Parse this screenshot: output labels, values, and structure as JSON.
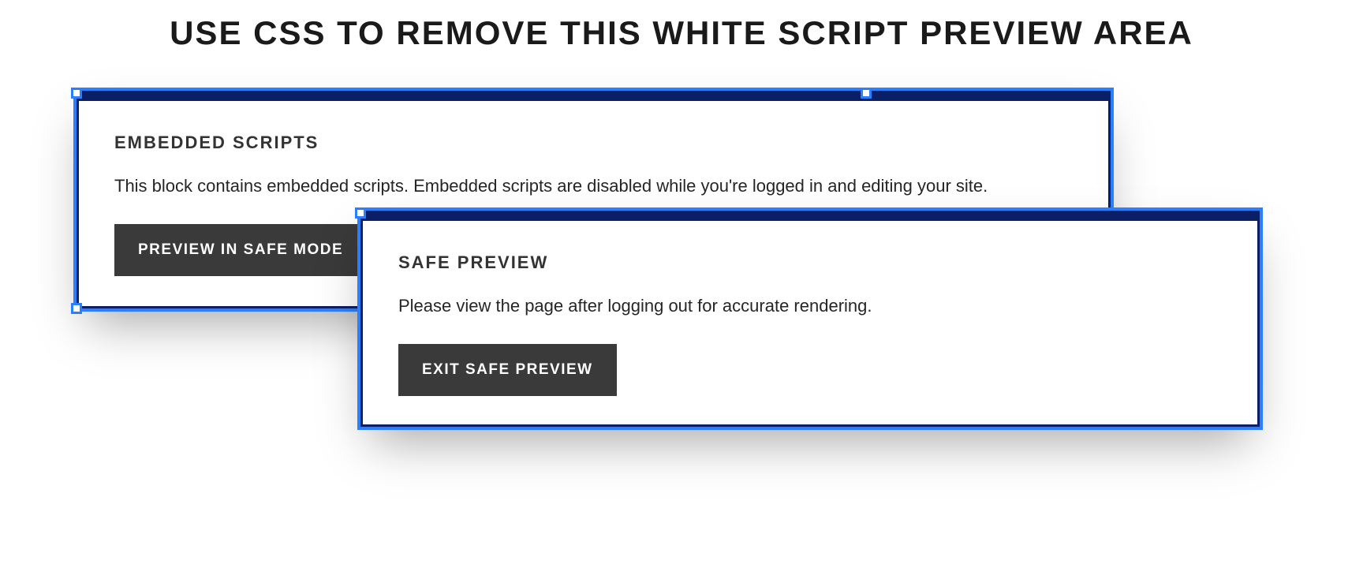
{
  "heading": "USE CSS TO REMOVE THIS WHITE SCRIPT PREVIEW AREA",
  "embedded": {
    "title": "EMBEDDED SCRIPTS",
    "text": "This block contains embedded scripts. Embedded scripts are disabled while you're logged in and editing your site.",
    "button": "PREVIEW IN SAFE MODE"
  },
  "safe": {
    "title": "SAFE PREVIEW",
    "text": "Please view the page after logging out for accurate rendering.",
    "button": "EXIT SAFE PREVIEW"
  }
}
